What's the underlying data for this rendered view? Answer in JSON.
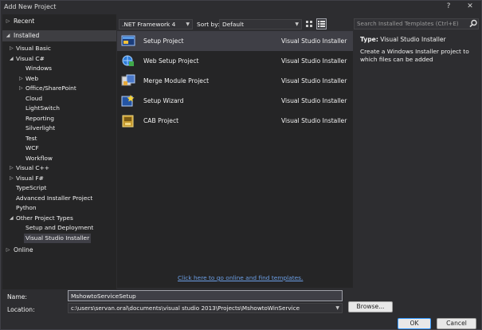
{
  "window": {
    "title": "Add New Project",
    "help": "?",
    "close": "✕"
  },
  "left": {
    "recent": "Recent",
    "installed": "Installed",
    "online": "Online",
    "tree": [
      {
        "label": "Visual Basic",
        "indent": 1,
        "arrow": "▷"
      },
      {
        "label": "Visual C#",
        "indent": 1,
        "arrow": "◢"
      },
      {
        "label": "Windows",
        "indent": 2
      },
      {
        "label": "Web",
        "indent": 2,
        "arrow": "▷"
      },
      {
        "label": "Office/SharePoint",
        "indent": 2,
        "arrow": "▷"
      },
      {
        "label": "Cloud",
        "indent": 2
      },
      {
        "label": "LightSwitch",
        "indent": 2
      },
      {
        "label": "Reporting",
        "indent": 2
      },
      {
        "label": "Silverlight",
        "indent": 2
      },
      {
        "label": "Test",
        "indent": 2
      },
      {
        "label": "WCF",
        "indent": 2
      },
      {
        "label": "Workflow",
        "indent": 2
      },
      {
        "label": "Visual C++",
        "indent": 1,
        "arrow": "▷"
      },
      {
        "label": "Visual F#",
        "indent": 1,
        "arrow": "▷"
      },
      {
        "label": "TypeScript",
        "indent": 1
      },
      {
        "label": "Advanced Installer Project",
        "indent": 1
      },
      {
        "label": "Python",
        "indent": 1
      },
      {
        "label": "Other Project Types",
        "indent": 1,
        "arrow": "◢"
      },
      {
        "label": "Setup and Deployment",
        "indent": 2
      },
      {
        "label": "Visual Studio Installer",
        "indent": 2,
        "selected": true
      }
    ]
  },
  "toolbar": {
    "framework": ".NET Framework 4",
    "sort_label": "Sort by:",
    "sort_value": "Default"
  },
  "search": {
    "placeholder": "Search Installed Templates (Ctrl+E)"
  },
  "templates": [
    {
      "name": "Setup Project",
      "type": "Visual Studio Installer",
      "selected": true
    },
    {
      "name": "Web Setup Project",
      "type": "Visual Studio Installer"
    },
    {
      "name": "Merge Module Project",
      "type": "Visual Studio Installer"
    },
    {
      "name": "Setup Wizard",
      "type": "Visual Studio Installer"
    },
    {
      "name": "CAB Project",
      "type": "Visual Studio Installer"
    }
  ],
  "online_link": "Click here to go online and find templates.",
  "details": {
    "type_label": "Type:",
    "type_value": "Visual Studio Installer",
    "description": "Create a Windows Installer project to which files can be added"
  },
  "form": {
    "name_label": "Name:",
    "name_value": "MshowtoServiceSetup",
    "location_label": "Location:",
    "location_value": "c:\\users\\servan.oral\\documents\\visual studio 2013\\Projects\\MshowtoWinService",
    "browse": "Browse...",
    "ok": "OK",
    "cancel": "Cancel"
  },
  "colors": {
    "background": "#2d2d30",
    "panel": "#252526",
    "selection": "#3f3f46",
    "link": "#6b9fe6"
  }
}
